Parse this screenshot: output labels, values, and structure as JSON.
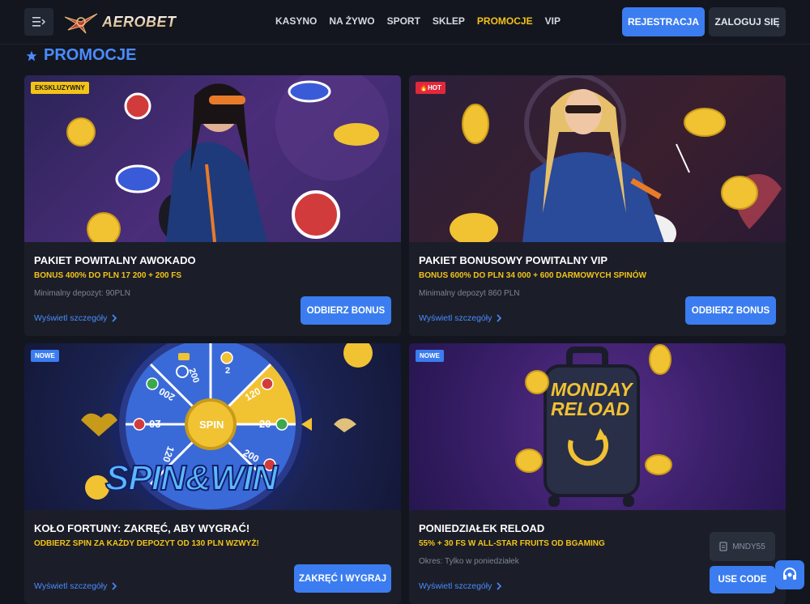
{
  "header": {
    "logo_text": "AEROBET",
    "nav": [
      "KASYNO",
      "NA ŻYWO",
      "SPORT",
      "SKLEP",
      "PROMOCJE",
      "VIP"
    ],
    "active_nav": "PROMOCJE",
    "register_label": "REJESTRACJA",
    "login_label": "ZALOGUJ SIĘ"
  },
  "page": {
    "title": "PROMOCJE"
  },
  "cards": [
    {
      "badge": "EKSKLUZYWNY",
      "title": "PAKIET POWITALNY AWOKADO",
      "bonus": "BONUS 400% DO PLN 17 200 + 200 FS",
      "sub": "Minimalny depozyt: 90PLN",
      "details": "Wyświetl szczegóły",
      "cta": "ODBIERZ BONUS"
    },
    {
      "badge": "HOT",
      "title": "PAKIET BONUSOWY POWITALNY VIP",
      "bonus": "BONUS 600% DO PLN 34 000 + 600 DARMOWYCH SPINÓW",
      "sub": "Minimalny depozyt 860 PLN",
      "details": "Wyświetl szczegóły",
      "cta": "ODBIERZ BONUS"
    },
    {
      "badge": "NOWE",
      "title": "KOŁO FORTUNY: ZAKRĘĆ, ABY WYGRAĆ!",
      "bonus": "ODBIERZ SPIN ZA KAŻDY DEPOZYT OD 130 PLN WZWYŻ!",
      "sub": "",
      "details": "Wyświetl szczegóły",
      "cta": "ZAKRĘĆ I WYGRAJ",
      "image_text": "SPIN&WIN",
      "wheel_center": "SPIN",
      "wheel_values": [
        "200",
        "2",
        "120",
        "20",
        "200",
        "120",
        "20",
        "200"
      ]
    },
    {
      "badge": "NOWE",
      "title": "PONIEDZIAŁEK RELOAD",
      "bonus": "55% + 30 FS W ALL-STAR FRUITS OD BGAMING",
      "sub": "Okres: Tylko w poniedziałek",
      "details": "Wyświetl szczegóły",
      "code": "MNDY55",
      "cta": "USE CODE",
      "image_text_line1": "MONDAY",
      "image_text_line2": "RELOAD"
    }
  ],
  "colors": {
    "accent": "#3b7df0",
    "highlight": "#f3c317",
    "bg": "#13161f",
    "card": "#1b1e29"
  }
}
